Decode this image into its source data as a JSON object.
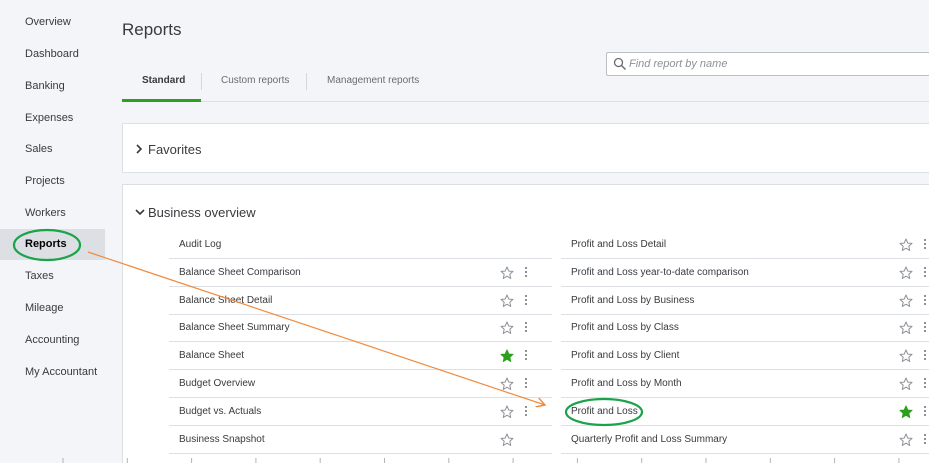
{
  "sidebar": {
    "items": [
      {
        "label": "Overview",
        "active": false
      },
      {
        "label": "Dashboard",
        "active": false
      },
      {
        "label": "Banking",
        "active": false
      },
      {
        "label": "Expenses",
        "active": false
      },
      {
        "label": "Sales",
        "active": false
      },
      {
        "label": "Projects",
        "active": false
      },
      {
        "label": "Workers",
        "active": false
      },
      {
        "label": "Reports",
        "active": true
      },
      {
        "label": "Taxes",
        "active": false
      },
      {
        "label": "Mileage",
        "active": false
      },
      {
        "label": "Accounting",
        "active": false
      },
      {
        "label": "My Accountant",
        "active": false
      }
    ]
  },
  "page": {
    "title": "Reports"
  },
  "tabs": [
    {
      "label": "Standard",
      "active": true
    },
    {
      "label": "Custom reports",
      "active": false
    },
    {
      "label": "Management reports",
      "active": false
    }
  ],
  "search": {
    "placeholder": "Find report by name"
  },
  "favorites": {
    "title": "Favorites",
    "expanded": false
  },
  "business_overview": {
    "title": "Business overview",
    "expanded": true,
    "left_reports": [
      {
        "name": "Audit Log",
        "favorite": null,
        "menu": false
      },
      {
        "name": "Balance Sheet Comparison",
        "favorite": false,
        "menu": true
      },
      {
        "name": "Balance Sheet Detail",
        "favorite": false,
        "menu": true
      },
      {
        "name": "Balance Sheet Summary",
        "favorite": false,
        "menu": true
      },
      {
        "name": "Balance Sheet",
        "favorite": true,
        "menu": true
      },
      {
        "name": "Budget Overview",
        "favorite": false,
        "menu": true
      },
      {
        "name": "Budget vs. Actuals",
        "favorite": false,
        "menu": true
      },
      {
        "name": "Business Snapshot",
        "favorite": false,
        "menu": false
      }
    ],
    "right_reports": [
      {
        "name": "Profit and Loss Detail",
        "favorite": false,
        "menu": true
      },
      {
        "name": "Profit and Loss year-to-date comparison",
        "favorite": false,
        "menu": true
      },
      {
        "name": "Profit and Loss by Business",
        "favorite": false,
        "menu": true
      },
      {
        "name": "Profit and Loss by Class",
        "favorite": false,
        "menu": true
      },
      {
        "name": "Profit and Loss by Client",
        "favorite": false,
        "menu": true
      },
      {
        "name": "Profit and Loss by Month",
        "favorite": false,
        "menu": true
      },
      {
        "name": "Profit and Loss",
        "favorite": true,
        "menu": true
      },
      {
        "name": "Quarterly Profit and Loss Summary",
        "favorite": false,
        "menu": true
      }
    ]
  },
  "colors": {
    "accent_green": "#2ca01c",
    "annotation_circle": "#1aa34a",
    "annotation_arrow": "#f08a3c",
    "star_outline": "#8d9096"
  },
  "annotations": {
    "circled": [
      "Reports",
      "Profit and Loss"
    ],
    "arrow": "from Reports to Profit and Loss"
  }
}
